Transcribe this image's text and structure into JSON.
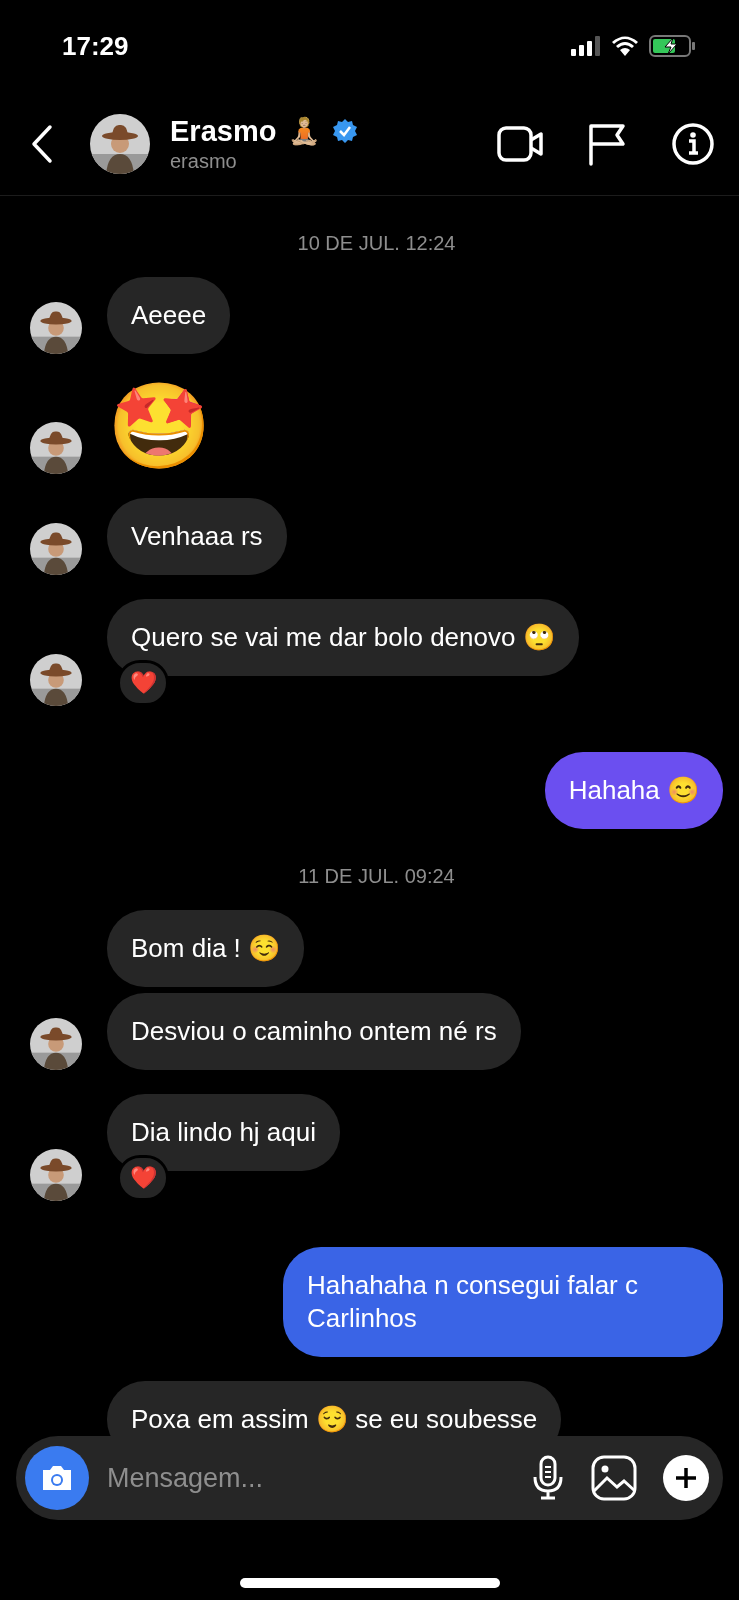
{
  "status_bar": {
    "time": "17:29"
  },
  "header": {
    "name": "Erasmo",
    "name_emoji": "🧘🏼",
    "verified": true,
    "username": "erasmo"
  },
  "messages": [
    {
      "kind": "date",
      "text": "10 DE JUL. 12:24"
    },
    {
      "kind": "in",
      "text": "Aeeee",
      "avatar": true
    },
    {
      "kind": "emoji",
      "text": "🤩",
      "avatar": true
    },
    {
      "kind": "in",
      "text": "Venhaaa rs",
      "avatar": true
    },
    {
      "kind": "in",
      "text": "Quero se vai me dar bolo denovo 🙄",
      "avatar": true,
      "reaction": "❤️"
    },
    {
      "kind": "out",
      "text": "Hahaha 😊",
      "color": "#6b4ff0"
    },
    {
      "kind": "date",
      "text": "11 DE JUL. 09:24"
    },
    {
      "kind": "in",
      "text": "Bom dia ! ☺️",
      "avatar": false
    },
    {
      "kind": "in",
      "text": "Desviou o caminho ontem né rs",
      "avatar": true
    },
    {
      "kind": "in",
      "text": "Dia lindo hj aqui",
      "avatar": true,
      "reaction": "❤️"
    },
    {
      "kind": "out",
      "text": "Hahahaha n consegui falar c Carlinhos",
      "color": "#3a64e6"
    },
    {
      "kind": "in",
      "text": "Poxa em assim 😌 se eu soubesse",
      "avatar": false
    }
  ],
  "composer": {
    "placeholder": "Mensagem..."
  }
}
